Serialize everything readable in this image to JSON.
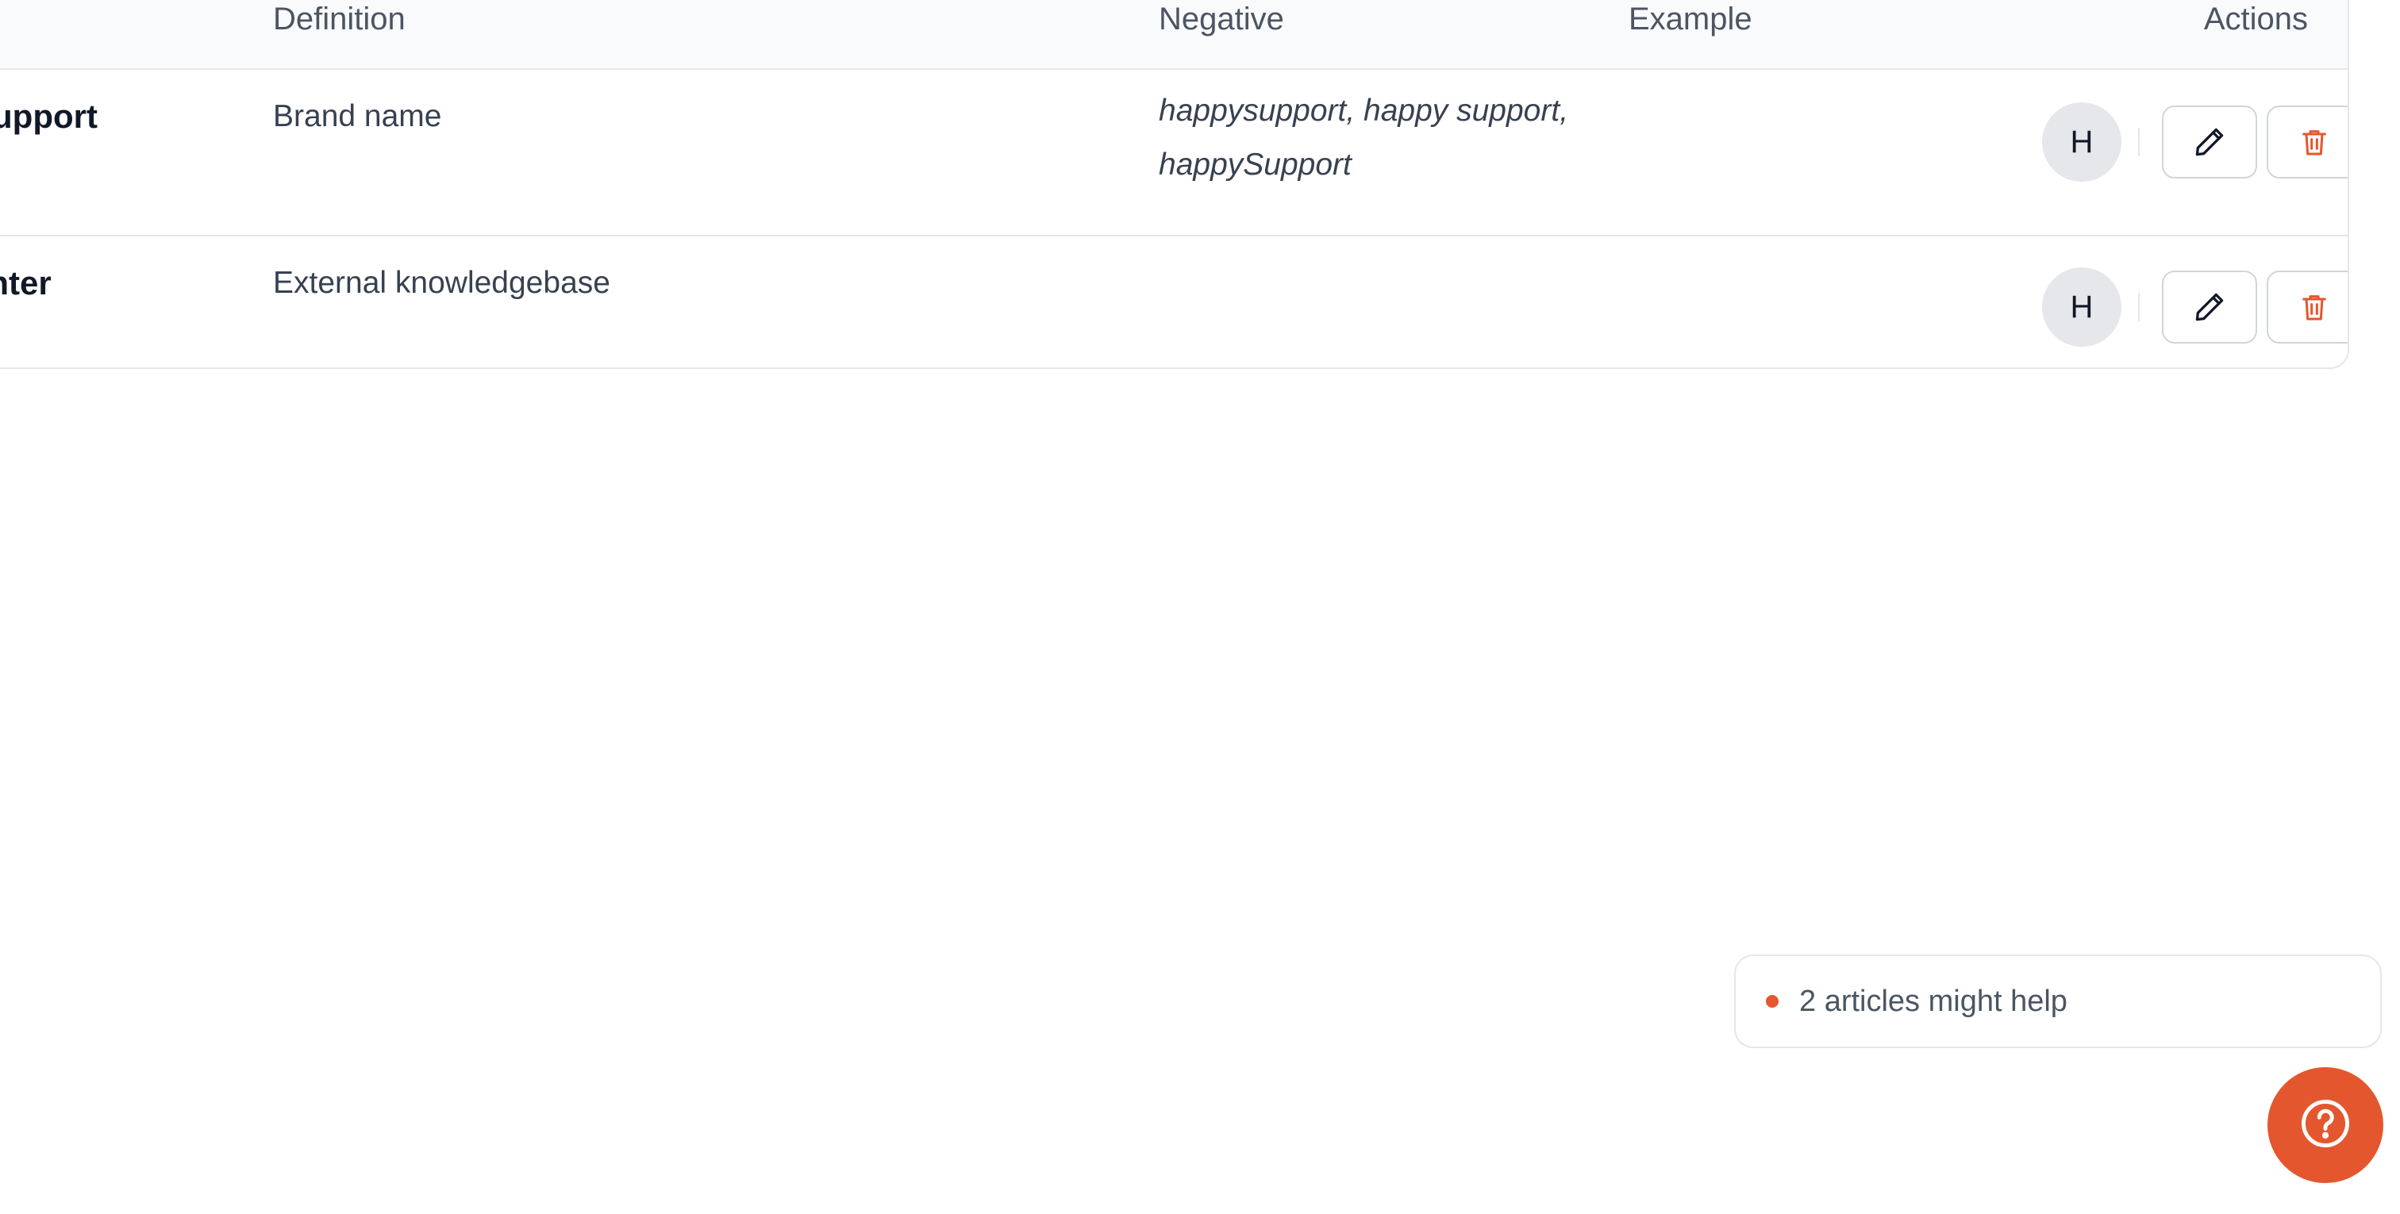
{
  "table": {
    "headers": {
      "definition": "Definition",
      "negative": "Negative",
      "example": "Example",
      "actions": "Actions"
    },
    "rows": [
      {
        "term": "Support",
        "definition": "Brand name",
        "negative": "happysupport, happy support, happySupport",
        "example": "",
        "avatar_initial": "H"
      },
      {
        "term": "enter",
        "definition": "External knowledgebase",
        "negative": "",
        "example": "",
        "avatar_initial": "H"
      }
    ]
  },
  "help_widget": {
    "suggestion_text": "2 articles might help",
    "fab_icon": "question-circle-icon"
  },
  "icons": {
    "edit": "pencil-icon",
    "delete": "trash-icon"
  },
  "colors": {
    "accent": "#e4572e",
    "delete": "#e4572e",
    "border": "#e5e7eb",
    "header_bg": "#f9fafb"
  }
}
